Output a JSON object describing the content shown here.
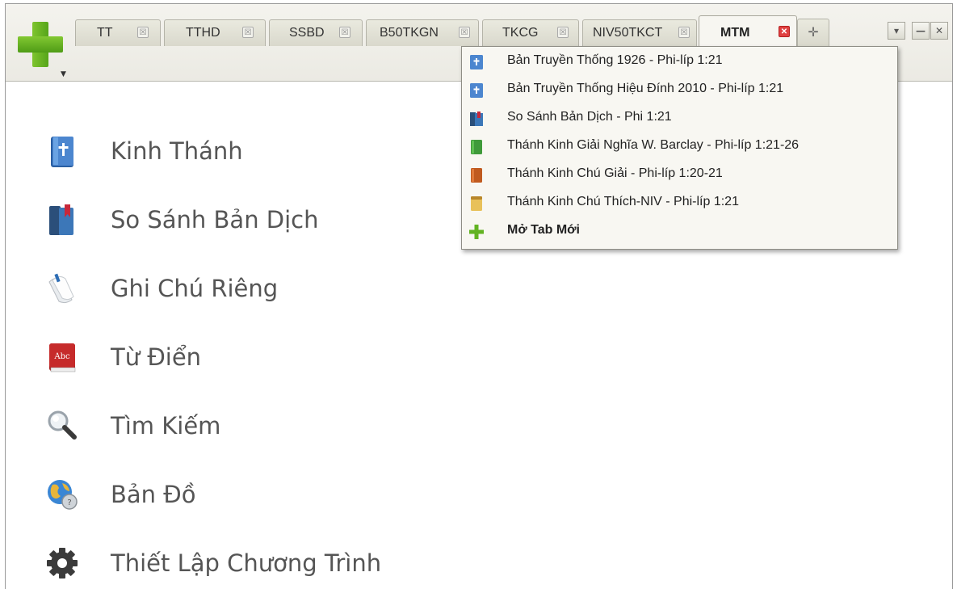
{
  "tabs": [
    {
      "label": "TT",
      "active": false
    },
    {
      "label": "TTHD",
      "active": false
    },
    {
      "label": "SSBD",
      "active": false
    },
    {
      "label": "B50TKGN",
      "active": false
    },
    {
      "label": "TKCG",
      "active": false
    },
    {
      "label": "NIV50TKCT",
      "active": false
    },
    {
      "label": "MTM",
      "active": true
    }
  ],
  "window_controls": {
    "list": "▾",
    "minimize": "—",
    "close": "✕",
    "new_tab": "✛",
    "tab_close": "☒",
    "active_close": "✕"
  },
  "main_menu": [
    {
      "label": "Kinh Thánh",
      "icon": "bible-icon"
    },
    {
      "label": "So Sánh Bản Dịch",
      "icon": "compare-books-icon"
    },
    {
      "label": "Ghi Chú Riêng",
      "icon": "notes-icon"
    },
    {
      "label": "Từ Điển",
      "icon": "dictionary-icon"
    },
    {
      "label": "Tìm Kiếm",
      "icon": "search-icon"
    },
    {
      "label": "Bản Đồ",
      "icon": "globe-icon"
    },
    {
      "label": "Thiết Lập Chương Trình",
      "icon": "gear-icon"
    }
  ],
  "dropdown": [
    {
      "label": "Bản Truyền Thống 1926 - Phi-líp 1:21",
      "icon": "bible-icon"
    },
    {
      "label": "Bản Truyền Thống Hiệu Đính 2010 - Phi-líp 1:21",
      "icon": "bible-icon"
    },
    {
      "label": "So Sánh Bản Dịch - Phi 1:21",
      "icon": "compare-books-icon"
    },
    {
      "label": "Thánh Kinh Giải Nghĩa W. Barclay - Phi-líp 1:21-26",
      "icon": "green-book-icon"
    },
    {
      "label": "Thánh Kinh Chú Giải - Phi-líp 1:20-21",
      "icon": "orange-book-icon"
    },
    {
      "label": "Thánh Kinh Chú Thích-NIV - Phi-líp 1:21",
      "icon": "yellow-book-icon"
    },
    {
      "label": "Mở Tab Mới",
      "icon": "plus-icon"
    }
  ]
}
